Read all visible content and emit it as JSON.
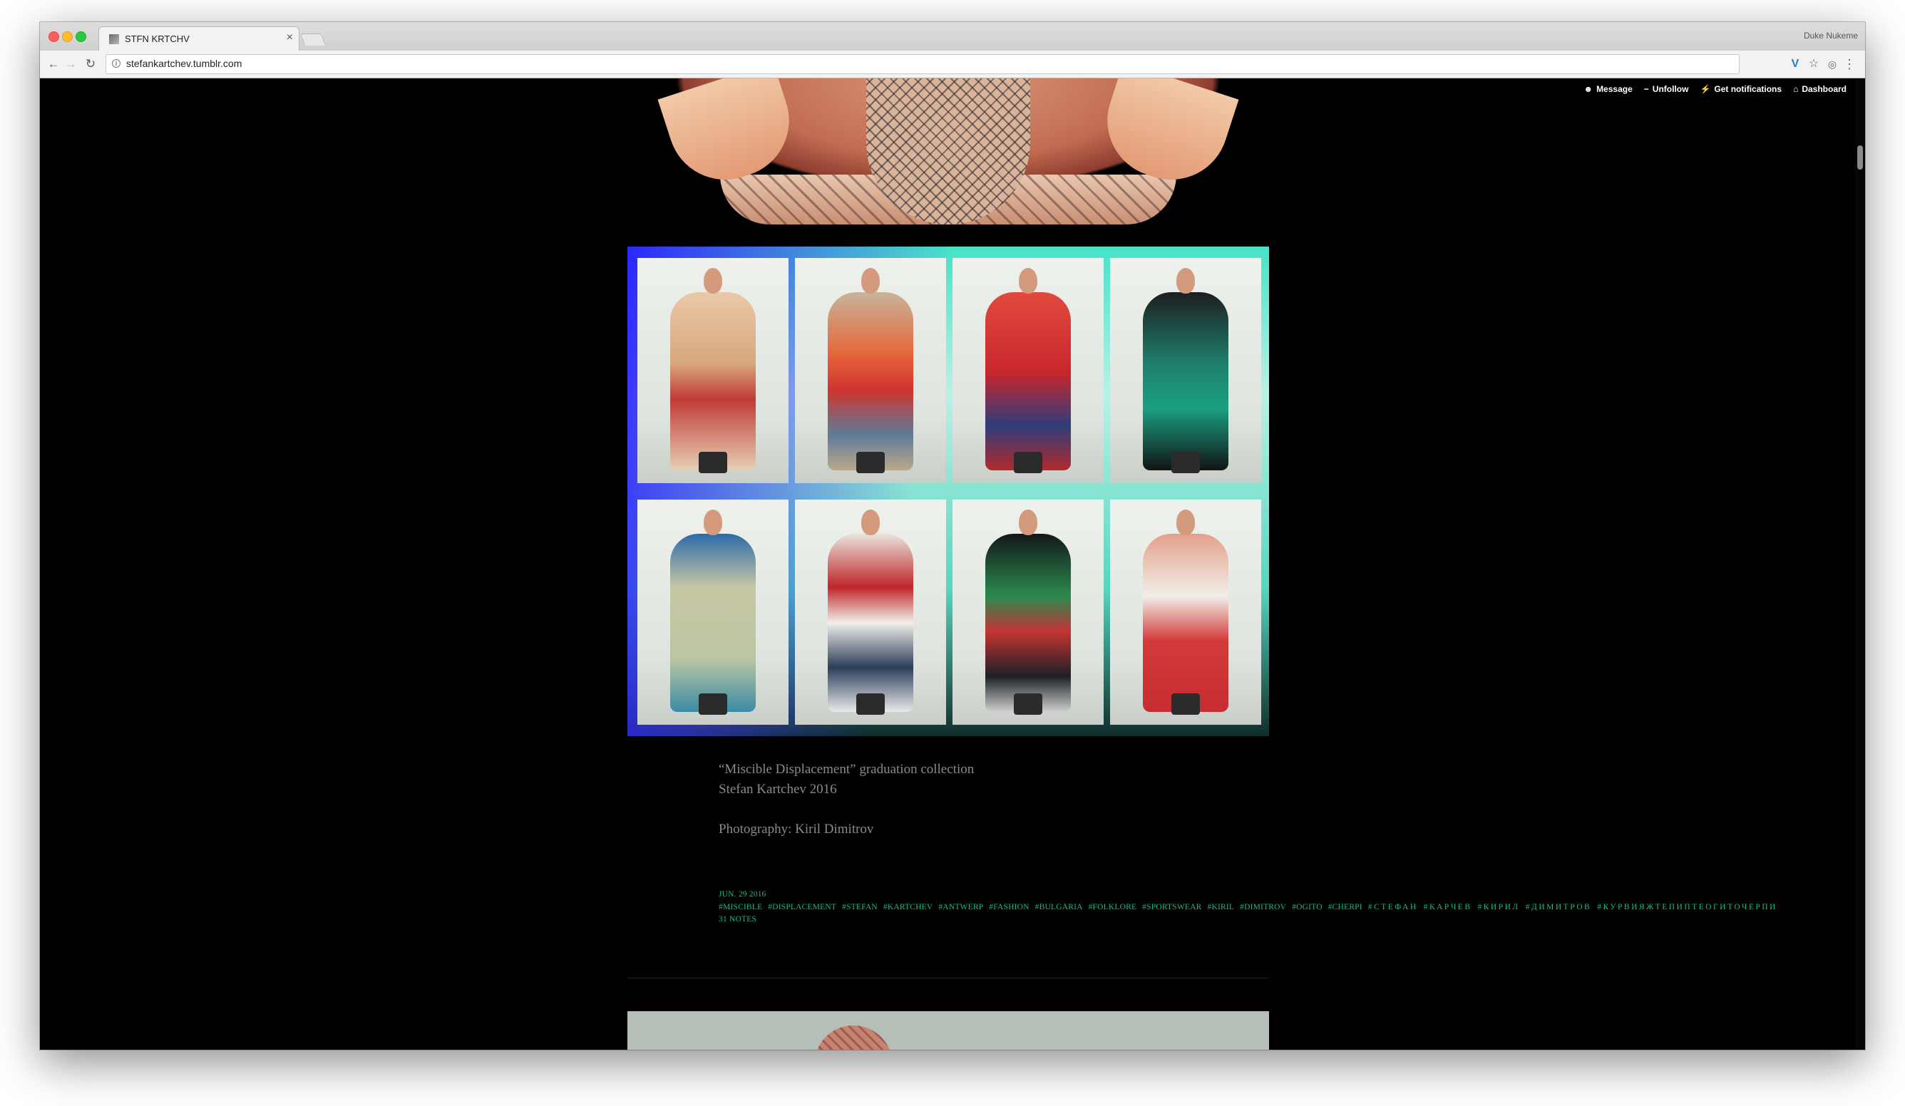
{
  "browser": {
    "tab_title": "STFN KRTCHV",
    "tab_close": "×",
    "profile_name": "Duke Nukeme",
    "url": "stefankartchev.tumblr.com",
    "nav": {
      "back": "←",
      "forward": "→",
      "reload": "↻"
    },
    "extensions": {
      "v": "V",
      "star": "☆",
      "shield": "◎",
      "menu": "⋮"
    }
  },
  "tumblr_controls": [
    {
      "icon": "☻",
      "icon_name": "message-icon",
      "label": "Message"
    },
    {
      "icon": "−",
      "icon_name": "minus-icon",
      "label": "Unfollow"
    },
    {
      "icon": "⚡",
      "icon_name": "lightning-icon",
      "label": "Get notifications"
    },
    {
      "icon": "⌂",
      "icon_name": "home-icon",
      "label": "Dashboard"
    }
  ],
  "post": {
    "caption_lines": [
      "“Miscible Displacement” graduation collection",
      "Stefan Kartchev 2016",
      "",
      "Photography: Kiril Dimitrov"
    ],
    "date": "JUN. 29 2016",
    "tags": [
      "#MISCIBLE",
      "#DISPLACEMENT",
      "#STEFAN",
      "#KARTCHEV",
      "#ANTWERP",
      "#FASHION",
      "#BULGARIA",
      "#FOLKLORE",
      "#SPORTSWEAR",
      "#KIRIL",
      "#DIMITROV",
      "#OGITO",
      "#CHERPI",
      "#СТЕФАН",
      "#КАРЧЕВ",
      "#КИРИЛ",
      "#ДИМИТРОВ",
      "#КУРВИЯЖТЕПИПТЕОГИТОЧЕРПИ"
    ],
    "notes": "31 NOTES"
  },
  "colors": {
    "page_bg": "#000000",
    "tag_green": "#1db88a",
    "caption_gray": "#8a8a8a"
  },
  "gallery_outfits": [
    {
      "body": "linear-gradient(180deg,#e9c9a8 0%,#d8a77e 40%,#c03b36 60%,#e6cfb4 100%)"
    },
    {
      "body": "linear-gradient(180deg,#c9b49a 0%,#e6653a 35%,#d0342f 55%,#5e7b9a 80%,#bda88a 100%)"
    },
    {
      "body": "linear-gradient(180deg,#e14a3e 0%,#c8262c 45%,#2f3d7a 75%,#b22a2c 100%)"
    },
    {
      "body": "linear-gradient(180deg,#1d1e20 0%,#1f7f6b 40%,#1aa07f 65%,#121416 100%)"
    },
    {
      "body": "linear-gradient(180deg,#2d6aa8 0%,#c6c7a4 30%,#bcc5a2 70%,#3a8ca6 100%)"
    },
    {
      "body": "linear-gradient(180deg,#e8e4dc 0%,#c0242a 30%,#f2f0ea 50%,#2b3d5a 75%,#eaeaea 100%)"
    },
    {
      "body": "linear-gradient(180deg,#13181a 0%,#2b8a4e 35%,#c43434 55%,#1c2024 80%,#cfcfcf 100%)"
    },
    {
      "body": "linear-gradient(180deg,#e3a08a 0%,#f1efe8 35%,#d33b3b 60%,#c72c30 100%)"
    }
  ]
}
